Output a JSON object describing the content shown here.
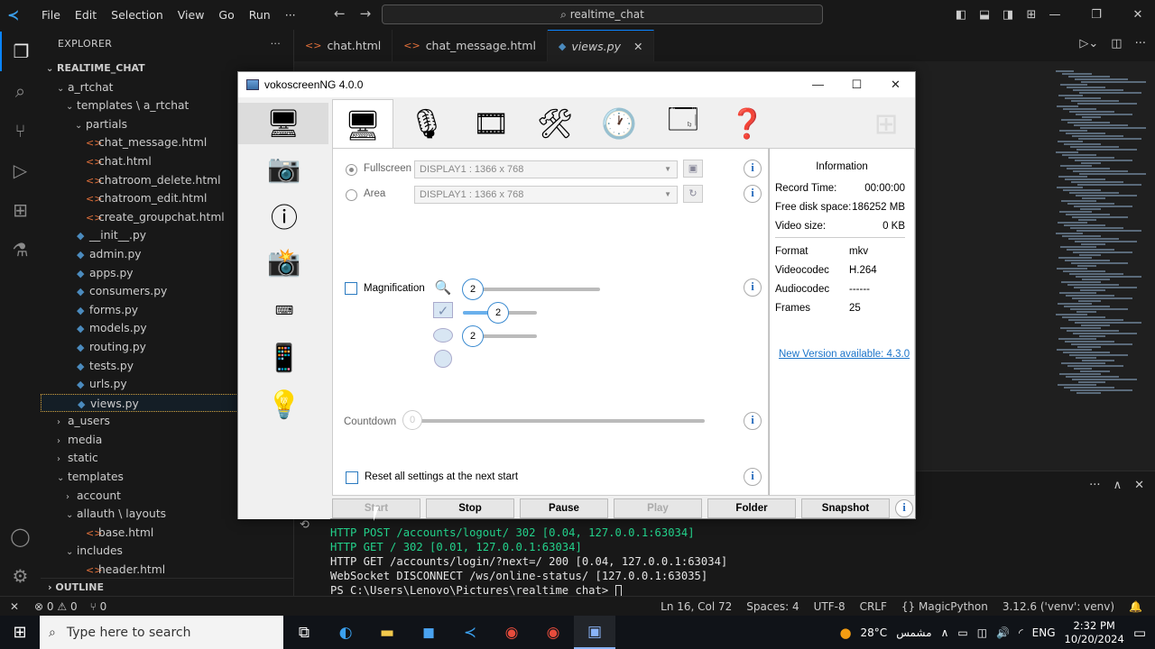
{
  "vscode": {
    "menu": [
      "File",
      "Edit",
      "Selection",
      "View",
      "Go",
      "Run",
      "···"
    ],
    "command_center": "realtime_chat",
    "explorer": {
      "header": "EXPLORER",
      "root": "REALTIME_CHAT",
      "tree": [
        {
          "label": "a_rtchat",
          "depth": 1,
          "type": "folder-open"
        },
        {
          "label": "templates \\ a_rtchat",
          "depth": 2,
          "type": "folder-open"
        },
        {
          "label": "partials",
          "depth": 3,
          "type": "folder-open"
        },
        {
          "label": "chat_message.html",
          "depth": 3,
          "type": "html"
        },
        {
          "label": "chat.html",
          "depth": 3,
          "type": "html"
        },
        {
          "label": "chatroom_delete.html",
          "depth": 3,
          "type": "html"
        },
        {
          "label": "chatroom_edit.html",
          "depth": 3,
          "type": "html"
        },
        {
          "label": "create_groupchat.html",
          "depth": 3,
          "type": "html"
        },
        {
          "label": "__init__.py",
          "depth": 2,
          "type": "py"
        },
        {
          "label": "admin.py",
          "depth": 2,
          "type": "py"
        },
        {
          "label": "apps.py",
          "depth": 2,
          "type": "py"
        },
        {
          "label": "consumers.py",
          "depth": 2,
          "type": "py"
        },
        {
          "label": "forms.py",
          "depth": 2,
          "type": "py"
        },
        {
          "label": "models.py",
          "depth": 2,
          "type": "py"
        },
        {
          "label": "routing.py",
          "depth": 2,
          "type": "py"
        },
        {
          "label": "tests.py",
          "depth": 2,
          "type": "py"
        },
        {
          "label": "urls.py",
          "depth": 2,
          "type": "py"
        },
        {
          "label": "views.py",
          "depth": 2,
          "type": "py",
          "selected": true
        },
        {
          "label": "a_users",
          "depth": 1,
          "type": "folder"
        },
        {
          "label": "media",
          "depth": 1,
          "type": "folder"
        },
        {
          "label": "static",
          "depth": 1,
          "type": "folder"
        },
        {
          "label": "templates",
          "depth": 1,
          "type": "folder-open"
        },
        {
          "label": "account",
          "depth": 2,
          "type": "folder"
        },
        {
          "label": "allauth \\ layouts",
          "depth": 2,
          "type": "folder-open"
        },
        {
          "label": "base.html",
          "depth": 3,
          "type": "html"
        },
        {
          "label": "includes",
          "depth": 2,
          "type": "folder-open"
        },
        {
          "label": "header.html",
          "depth": 3,
          "type": "html"
        }
      ],
      "outline": "OUTLINE"
    },
    "tabs": [
      {
        "label": "chat.html",
        "type": "html"
      },
      {
        "label": "chat_message.html",
        "type": "html"
      },
      {
        "label": "views.py",
        "type": "py",
        "active": true
      }
    ],
    "terminal_lines": [
      {
        "text": "HTTP POST /accounts/logout/ 302 [0.04, 127.0.0.1:63034]",
        "color": "g"
      },
      {
        "text": "HTTP GET / 302 [0.01, 127.0.0.1:63034]",
        "color": "g"
      },
      {
        "text": "HTTP GET /accounts/login/?next=/ 200 [0.04, 127.0.0.1:63034]",
        "color": "w"
      },
      {
        "text": "WebSocket DISCONNECT /ws/online-status/ [127.0.0.1:63035]",
        "color": "w"
      },
      {
        "text": "PS C:\\Users\\Lenovo\\Pictures\\realtime_chat> ",
        "color": "w"
      }
    ],
    "status": {
      "errors": "0",
      "warnings": "0",
      "ports": "0",
      "position": "Ln 16, Col 72",
      "spaces": "Spaces: 4",
      "encoding": "UTF-8",
      "eol": "CRLF",
      "language": "MagicPython",
      "interpreter": "3.12.6 ('venv': venv)"
    }
  },
  "vokoscreen": {
    "title": "vokoscreenNG 4.0.0",
    "fullscreen_label": "Fullscreen",
    "area_label": "Area",
    "display_option": "DISPLAY1 :  1366 x 768",
    "magnification_label": "Magnification",
    "mag_values": [
      "2",
      "2",
      "2"
    ],
    "countdown_label": "Countdown",
    "countdown_value": "0",
    "reset_label": "Reset all settings at the next start",
    "info": {
      "header": "Information",
      "record_time_k": "Record Time:",
      "record_time_v": "00:00:00",
      "free_disk_k": "Free disk space:",
      "free_disk_v": "186252  MB",
      "video_size_k": "Video size:",
      "video_size_v": "0  KB",
      "format_k": "Format",
      "format_v": "mkv",
      "vcodec_k": "Videocodec",
      "vcodec_v": "H.264",
      "acodec_k": "Audiocodec",
      "acodec_v": "------",
      "frames_k": "Frames",
      "frames_v": "25",
      "new_version": "New Version available: 4.3.0"
    },
    "buttons": {
      "start": "Start",
      "stop": "Stop",
      "pause": "Pause",
      "play": "Play",
      "folder": "Folder",
      "snapshot": "Snapshot"
    }
  },
  "taskbar": {
    "search_placeholder": "Type here to search",
    "weather": "28°C",
    "weather_text": "مشمس",
    "lang": "ENG",
    "time": "2:32 PM",
    "date": "10/20/2024"
  }
}
